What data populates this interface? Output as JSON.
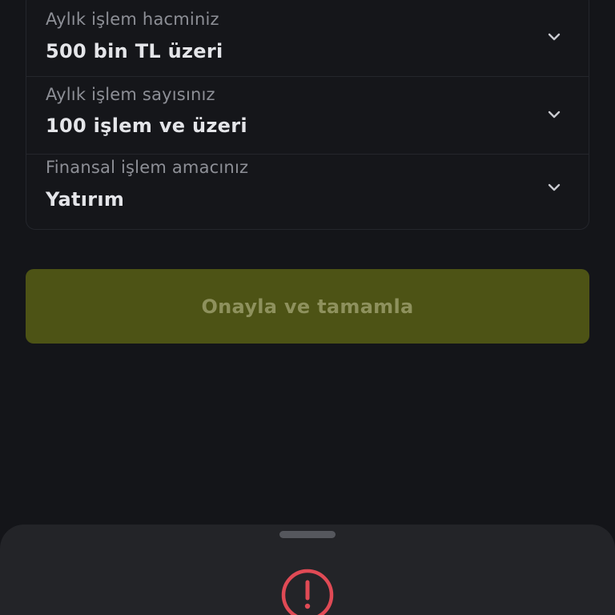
{
  "form": {
    "fields": [
      {
        "label": "Aylık işlem hacminiz",
        "value": "500 bin TL üzeri",
        "icon": "chevron-down-icon"
      },
      {
        "label": "Aylık işlem sayısınız",
        "value": "100 işlem ve üzeri",
        "icon": "chevron-down-icon"
      },
      {
        "label": "Finansal işlem amacınız",
        "value": "Yatırım",
        "icon": "chevron-down-icon"
      }
    ]
  },
  "confirm_button": {
    "label": "Onayla ve tamamla"
  },
  "bottom_sheet": {
    "icon": "alert-circle-icon"
  },
  "colors": {
    "background": "#141519",
    "button_bg": "#4d5315",
    "button_text": "#8e915d",
    "alert": "#e04a55",
    "sheet_bg": "#232428"
  }
}
